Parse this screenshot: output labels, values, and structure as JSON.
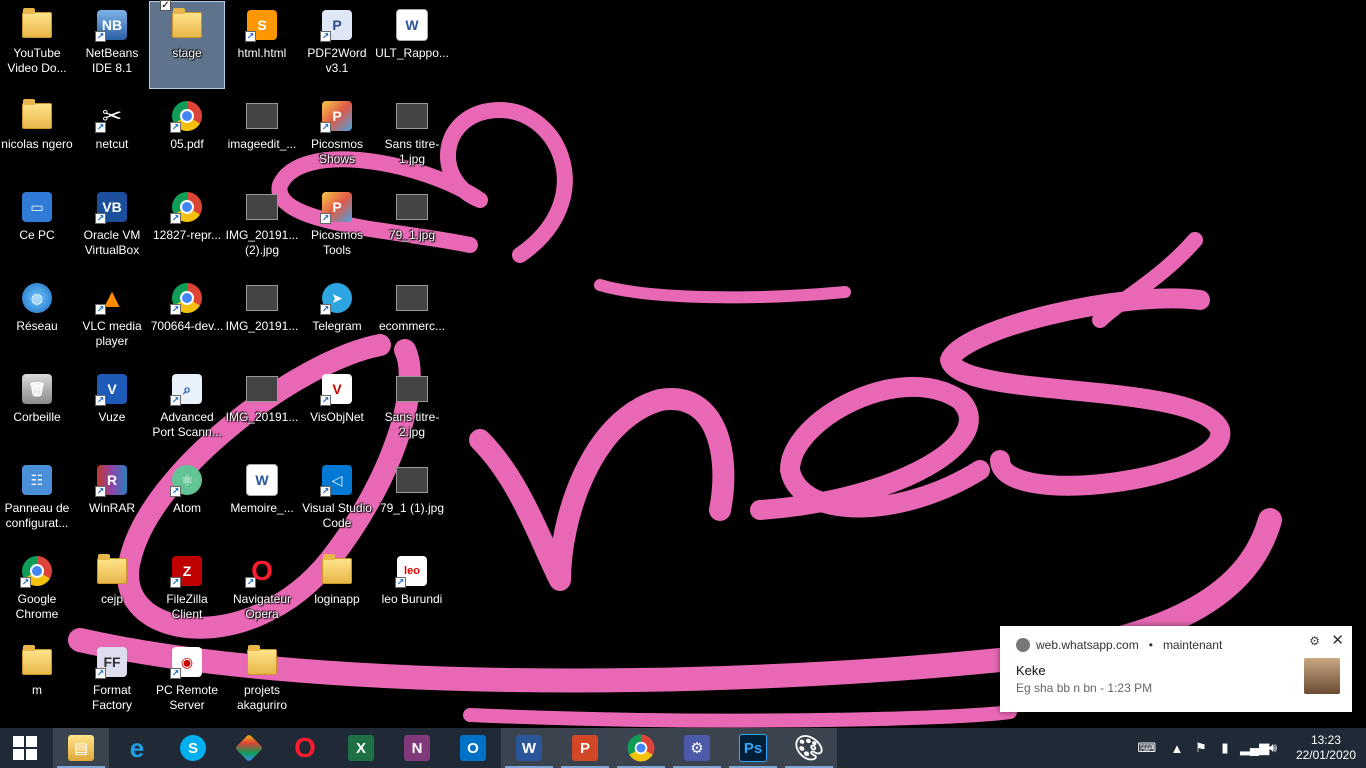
{
  "desktop": {
    "icons": [
      {
        "label": "YouTube Video Do...",
        "icon": "folder-icon"
      },
      {
        "label": "NetBeans IDE 8.1",
        "icon": "netbeans-icon"
      },
      {
        "label": "stage",
        "icon": "folder-icon"
      },
      {
        "label": "html.html",
        "icon": "sublime-icon"
      },
      {
        "label": "PDF2Word v3.1",
        "icon": "pdf2word-icon"
      },
      {
        "label": "ULT_Rappo...",
        "icon": "word-document-icon"
      },
      {
        "label": "nicolas ngero",
        "icon": "folder-icon"
      },
      {
        "label": "netcut",
        "icon": "scissors-icon"
      },
      {
        "label": "05.pdf",
        "icon": "chrome-icon"
      },
      {
        "label": "imageedit_...",
        "icon": "image-thumbnail-icon"
      },
      {
        "label": "Picosmos Shows",
        "icon": "picosmos-icon"
      },
      {
        "label": "Sans titre-1.jpg",
        "icon": "image-thumbnail-icon"
      },
      {
        "label": "Ce PC",
        "icon": "computer-icon"
      },
      {
        "label": "Oracle VM VirtualBox",
        "icon": "virtualbox-icon"
      },
      {
        "label": "12827-repr...",
        "icon": "chrome-icon"
      },
      {
        "label": "IMG_20191... (2).jpg",
        "icon": "image-thumbnail-icon"
      },
      {
        "label": "Picosmos Tools",
        "icon": "picosmos-icon"
      },
      {
        "label": "79_1.jpg",
        "icon": "image-thumbnail-icon"
      },
      {
        "label": "Réseau",
        "icon": "network-icon"
      },
      {
        "label": "VLC media player",
        "icon": "vlc-icon"
      },
      {
        "label": "700664-dev...",
        "icon": "chrome-icon"
      },
      {
        "label": "IMG_20191...",
        "icon": "image-thumbnail-icon"
      },
      {
        "label": "Telegram",
        "icon": "telegram-icon"
      },
      {
        "label": "ecommerc...",
        "icon": "image-thumbnail-icon"
      },
      {
        "label": "Corbeille",
        "icon": "recycle-bin-icon"
      },
      {
        "label": "Vuze",
        "icon": "vuze-icon"
      },
      {
        "label": "Advanced Port Scann...",
        "icon": "port-scanner-icon"
      },
      {
        "label": "IMG_20191...",
        "icon": "image-thumbnail-icon"
      },
      {
        "label": "VisObjNet",
        "icon": "visobjnet-icon"
      },
      {
        "label": "Sans titre-2.jpg",
        "icon": "image-thumbnail-icon"
      },
      {
        "label": "Panneau de configurat...",
        "icon": "control-panel-icon"
      },
      {
        "label": "WinRAR",
        "icon": "winrar-icon"
      },
      {
        "label": "Atom",
        "icon": "atom-icon"
      },
      {
        "label": "Memoire_...",
        "icon": "word-document-icon"
      },
      {
        "label": "Visual Studio Code",
        "icon": "vscode-icon"
      },
      {
        "label": "79_1 (1).jpg",
        "icon": "image-thumbnail-icon"
      },
      {
        "label": "Google Chrome",
        "icon": "chrome-icon"
      },
      {
        "label": "cejp",
        "icon": "folder-icon"
      },
      {
        "label": "FileZilla Client",
        "icon": "filezilla-icon"
      },
      {
        "label": "Navigateur Opera",
        "icon": "opera-icon"
      },
      {
        "label": "loginapp",
        "icon": "folder-icon"
      },
      {
        "label": "leo Burundi",
        "icon": "leo-icon"
      },
      {
        "label": "m",
        "icon": "folder-icon"
      },
      {
        "label": "Format Factory",
        "icon": "format-factory-icon"
      },
      {
        "label": "PC Remote Server",
        "icon": "pc-remote-icon"
      },
      {
        "label": "projets akaguriro",
        "icon": "folder-icon"
      }
    ],
    "selected_label": "stage"
  },
  "notification": {
    "source": "web.whatsapp.com",
    "separator": "•",
    "time": "maintenant",
    "title": "Keke",
    "body": "Eg sha bb n bn - 1:23 PM"
  },
  "taskbar": {
    "items": [
      {
        "name": "start-button",
        "icon": "windows-logo-icon"
      },
      {
        "name": "file-explorer",
        "icon": "file-explorer-icon"
      },
      {
        "name": "internet-explorer",
        "icon": "internet-explorer-icon"
      },
      {
        "name": "skype",
        "icon": "skype-icon"
      },
      {
        "name": "git-app",
        "icon": "git-icon"
      },
      {
        "name": "opera",
        "icon": "opera-icon"
      },
      {
        "name": "excel",
        "icon": "excel-icon"
      },
      {
        "name": "onenote",
        "icon": "onenote-icon"
      },
      {
        "name": "outlook",
        "icon": "outlook-icon"
      },
      {
        "name": "word",
        "icon": "word-icon"
      },
      {
        "name": "powerpoint",
        "icon": "powerpoint-icon"
      },
      {
        "name": "chrome",
        "icon": "chrome-icon"
      },
      {
        "name": "settings",
        "icon": "settings-gear-icon"
      },
      {
        "name": "photoshop",
        "icon": "photoshop-icon"
      },
      {
        "name": "paint",
        "icon": "paint-palette-icon"
      }
    ],
    "clock": {
      "time": "13:23",
      "date": "22/01/2020"
    }
  },
  "colors": {
    "taskbar": "#1f2a36",
    "wallpaper_bg": "#000000",
    "wallpaper_script": "#e868b5"
  }
}
